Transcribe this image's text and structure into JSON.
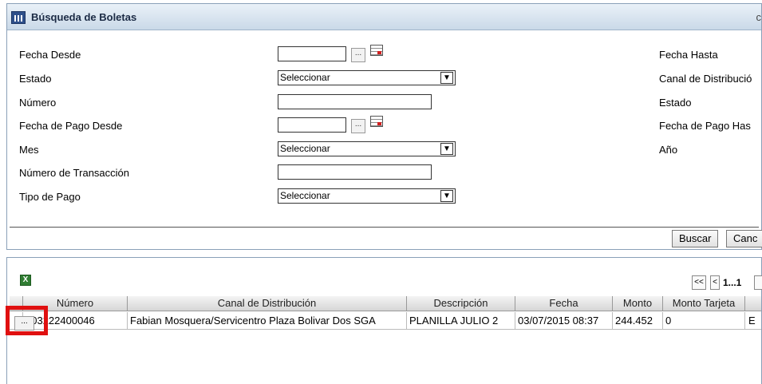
{
  "panel": {
    "title": "Búsqueda de Boletas",
    "title_right": "c"
  },
  "filters": {
    "fecha_desde": "Fecha Desde",
    "estado": "Estado",
    "numero": "Número",
    "fecha_pago_desde": "Fecha de Pago Desde",
    "mes": "Mes",
    "numero_transaccion": "Número de Transacción",
    "tipo_pago": "Tipo de Pago",
    "fecha_hasta": "Fecha Hasta",
    "canal_distribucion": "Canal de Distribució",
    "estado_right": "Estado",
    "fecha_pago_hasta": "Fecha de Pago Has",
    "anio": "Año",
    "select_placeholder": "Seleccionar",
    "dots": "...",
    "arrow": "▼"
  },
  "buttons": {
    "buscar": "Buscar",
    "cancelar": "Canc"
  },
  "pagination": {
    "first": "<<",
    "prev": "<",
    "pages": "1...1"
  },
  "results": {
    "excel_icon_letter": "X",
    "columns": [
      "Número",
      "Canal de Distribución",
      "Descripción",
      "Fecha",
      "Monto",
      "Monto Tarjeta"
    ],
    "rows": [
      {
        "numero": "103222400046",
        "canal": "Fabian Mosquera/Servicentro Plaza Bolivar Dos SGA",
        "descripcion": "PLANILLA JULIO 2",
        "fecha": "03/07/2015 08:37",
        "monto": "244.452",
        "monto_tarjeta": "0",
        "extra": "E"
      }
    ],
    "row_button": "..."
  },
  "colors": {
    "highlight": "#e01010",
    "titlebar": "#cad9e8"
  }
}
